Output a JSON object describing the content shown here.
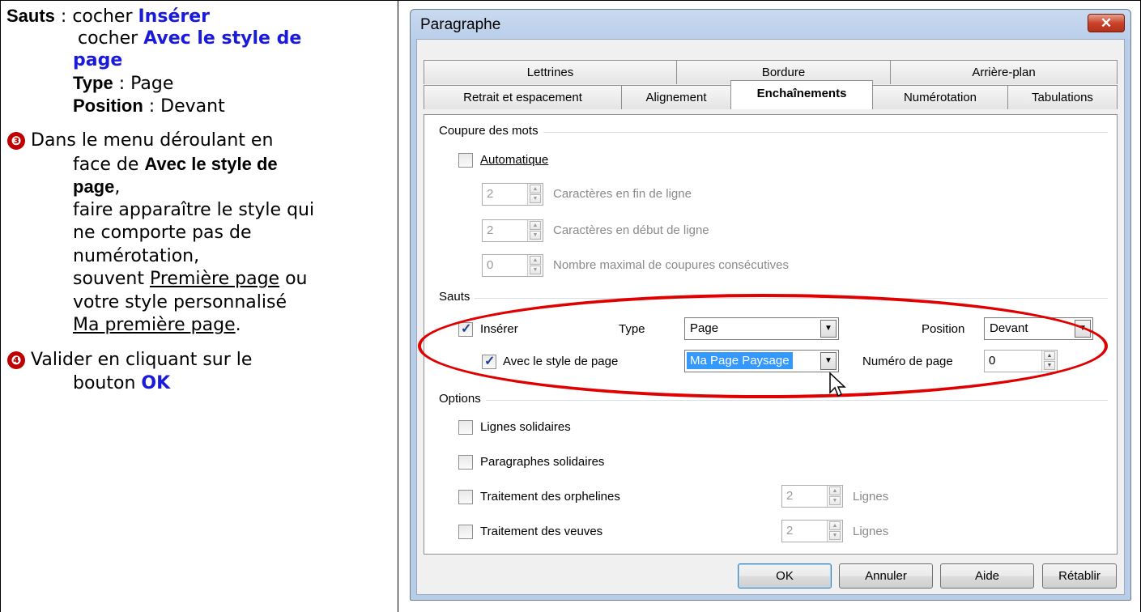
{
  "instructions": {
    "l1_bold": "Sauts",
    "l1_text": " : cocher ",
    "l1_blue": "Insérer",
    "l2_text": "cocher ",
    "l2_blue": "Avec le style de",
    "l3_blue": "page",
    "l4_bold": "Type",
    "l4_text": " : Page",
    "l5_bold": "Position",
    "l5_text": " : Devant",
    "b3": "❸",
    "l6": "Dans le menu déroulant en",
    "l7_text": "face de ",
    "l7_bold": "Avec le style de",
    "l8_bold": "page",
    "l8_text": ",",
    "l9": "faire apparaître le style qui",
    "l10": "ne comporte pas de",
    "l11": "numérotation,",
    "l12_text": "souvent ",
    "l12_u": "Première page",
    "l12_end": " ou",
    "l13": "votre style personnalisé",
    "l14_u": "Ma première page",
    "l14_end": ".",
    "b4": "❹",
    "l15": "Valider en cliquant sur le",
    "l16_text": "bouton ",
    "l16_blue": "OK"
  },
  "dialog": {
    "title": "Paragraphe",
    "close_glyph": "✕",
    "tabs_row1": [
      "Lettrines",
      "Bordure",
      "Arrière-plan"
    ],
    "tabs_row2": [
      "Retrait et espacement",
      "Alignement",
      "Enchaînements",
      "Numérotation",
      "Tabulations"
    ],
    "active_tab": "Enchaînements",
    "hyphenation": {
      "heading": "Coupure des mots",
      "automatic": "Automatique",
      "end_value": "2",
      "end_label": "Caractères en fin de ligne",
      "start_value": "2",
      "start_label": "Caractères en début de ligne",
      "max_value": "0",
      "max_label": "Nombre maximal de coupures consécutives"
    },
    "breaks": {
      "heading": "Sauts",
      "insert": "Insérer",
      "type_label": "Type",
      "type_value": "Page",
      "position_label": "Position",
      "position_value": "Devant",
      "with_style": "Avec le style de page",
      "style_value": "Ma Page Paysage",
      "page_number_label": "Numéro de page",
      "page_number_value": "0"
    },
    "options": {
      "heading": "Options",
      "keep_lines": "Lignes solidaires",
      "keep_paragraphs": "Paragraphes solidaires",
      "orphans": "Traitement des orphelines",
      "orphans_value": "2",
      "orphans_unit": "Lignes",
      "widows": "Traitement des veuves",
      "widows_value": "2",
      "widows_unit": "Lignes"
    },
    "buttons": {
      "ok": "OK",
      "cancel": "Annuler",
      "help": "Aide",
      "reset": "Rétablir"
    }
  }
}
